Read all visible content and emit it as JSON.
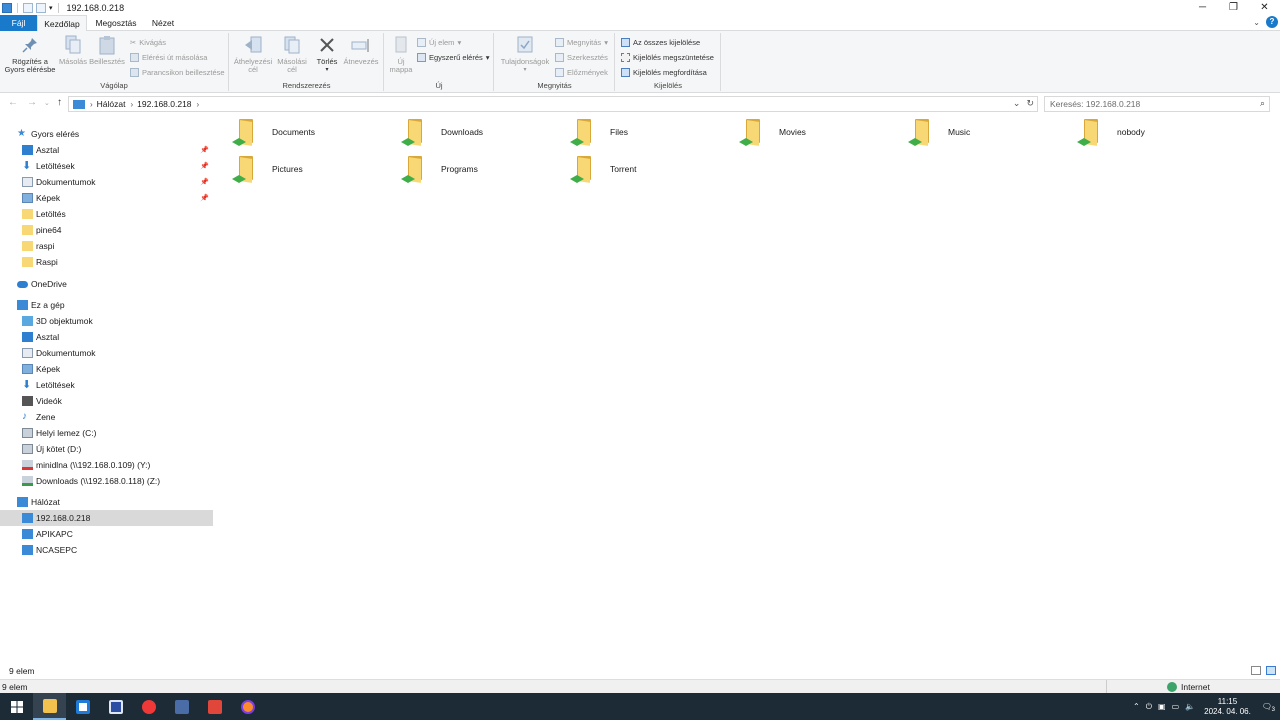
{
  "window": {
    "title": "192.168.0.218"
  },
  "tabs": {
    "file": "Fájl",
    "home": "Kezdőlap",
    "share": "Megosztás",
    "view": "Nézet"
  },
  "ribbon": {
    "clipboard": {
      "group": "Vágólap",
      "pin_line1": "Rögzítés a",
      "pin_line2": "Gyors elérésbe",
      "copy": "Másolás",
      "paste": "Beillesztés",
      "cut": "Kivágás",
      "copy_path": "Elérési út másolása",
      "paste_shortcut": "Parancsikon beillesztése"
    },
    "organize": {
      "group": "Rendszerezés",
      "move_line1": "Áthelyezési",
      "move_line2": "cél",
      "copyto_line1": "Másolási",
      "copyto_line2": "cél",
      "delete": "Törlés",
      "rename": "Átnevezés"
    },
    "new": {
      "group": "Új",
      "newfolder_line1": "Új",
      "newfolder_line2": "mappa",
      "new_item": "Új elem",
      "easy_access": "Egyszerű elérés"
    },
    "open": {
      "group": "Megnyitás",
      "properties": "Tulajdonságok",
      "open": "Megnyitás",
      "edit": "Szerkesztés",
      "history": "Előzmények"
    },
    "select": {
      "group": "Kijelölés",
      "select_all": "Az összes kijelölése",
      "select_none": "Kijelölés megszüntetése",
      "invert": "Kijelölés megfordítása"
    }
  },
  "address": {
    "root": "Hálózat",
    "current": "192.168.0.218"
  },
  "search": {
    "placeholder": "Keresés: 192.168.0.218"
  },
  "nav": {
    "quick_access": "Gyors elérés",
    "qa_items": [
      "Asztal",
      "Letöltések",
      "Dokumentumok",
      "Képek",
      "Letöltés",
      "pine64",
      "raspi",
      "Raspi"
    ],
    "onedrive": "OneDrive",
    "this_pc": "Ez a gép",
    "pc_items": [
      "3D objektumok",
      "Asztal",
      "Dokumentumok",
      "Képek",
      "Letöltések",
      "Videók",
      "Zene",
      "Helyi lemez (C:)",
      "Új kötet (D:)",
      "minidlna (\\\\192.168.0.109) (Y:)",
      "Downloads (\\\\192.168.0.118) (Z:)"
    ],
    "network": "Hálózat",
    "net_items": [
      "192.168.0.218",
      "APIKAPC",
      "NCASEPC"
    ]
  },
  "folders": [
    "Documents",
    "Downloads",
    "Files",
    "Movies",
    "Music",
    "nobody",
    "Pictures",
    "Programs",
    "Torrent"
  ],
  "status": {
    "count": "9 elem",
    "count2": "9 elem",
    "zone": "Internet"
  },
  "taskbar": {
    "time": "11:15",
    "date": "2024. 04. 06.",
    "notif": "3"
  },
  "colors": {
    "accent": "#1979ca",
    "taskbar": "#1d2b36",
    "selection": "#d9d9d9",
    "folder": "#f8d775"
  }
}
